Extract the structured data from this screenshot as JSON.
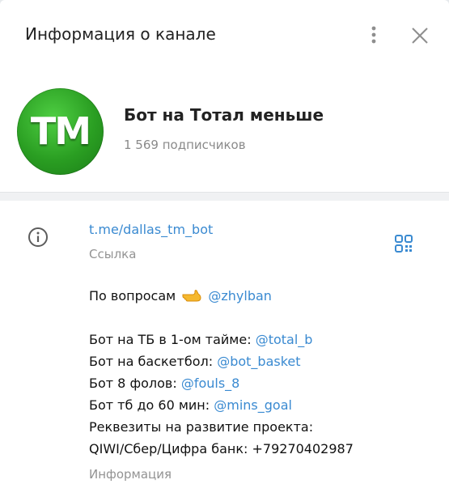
{
  "header": {
    "title": "Информация о канале"
  },
  "channel": {
    "avatar_text": "TM",
    "name": "Бот на Тотал меньше",
    "subscribers": "1 569 подписчиков"
  },
  "info": {
    "link": "t.me/dallas_tm_bot",
    "link_caption": "Ссылка",
    "questions_prefix": "По вопросам",
    "questions_emoji": "pointing-hand-emoji",
    "questions_mention": "@zhylban",
    "lines": [
      {
        "text": "Бот на ТБ в 1-ом тайме: ",
        "mention": "@total_b"
      },
      {
        "text": "Бот на баскетбол: ",
        "mention": "@bot_basket"
      },
      {
        "text": "Бот 8 фолов: ",
        "mention": "@fouls_8"
      },
      {
        "text": "Бот тб до 60 мин: ",
        "mention": "@mins_goal"
      }
    ],
    "requisites_line1": "Реквезиты на развитие проекта:",
    "requisites_line2": "QIWI/Сбер/Цифра банк: +79270402987",
    "info_caption": "Информация"
  },
  "icons": {
    "menu": "more-vertical-icon",
    "close": "close-icon",
    "info": "info-circle-icon",
    "qr": "qr-code-icon"
  },
  "colors": {
    "accent": "#3a8ad1",
    "avatar_green": "#2a9e22",
    "muted": "#939393"
  }
}
